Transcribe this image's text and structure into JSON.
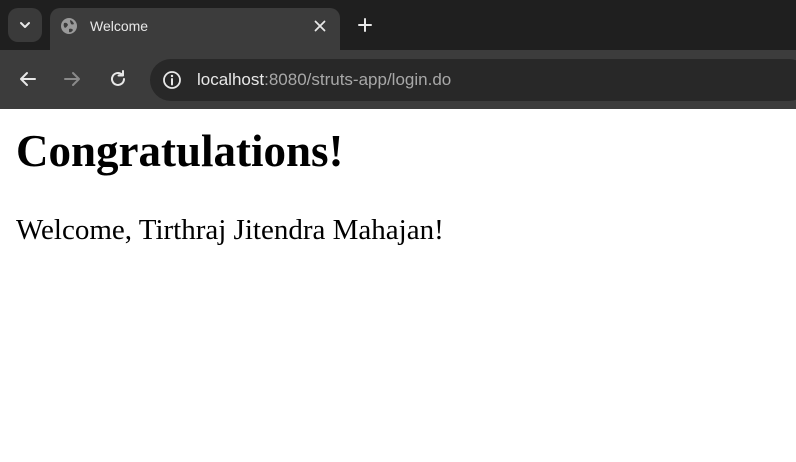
{
  "browser": {
    "tab": {
      "title": "Welcome",
      "favicon": "globe-icon"
    },
    "toolbar": {
      "url_host": "localhost",
      "url_rest": ":8080/struts-app/login.do"
    },
    "icons": {
      "tab_search": "chevron-down-icon",
      "close": "close-icon",
      "new_tab": "plus-icon",
      "back": "arrow-left-icon",
      "forward": "arrow-right-icon",
      "reload": "reload-icon",
      "site_info": "info-icon"
    },
    "colors": {
      "tab_strip": "#1f1f1f",
      "toolbar": "#3c3c3c",
      "omnibox": "#282828"
    }
  },
  "page": {
    "heading": "Congratulations!",
    "message": "Welcome, Tirthraj Jitendra Mahajan!"
  }
}
